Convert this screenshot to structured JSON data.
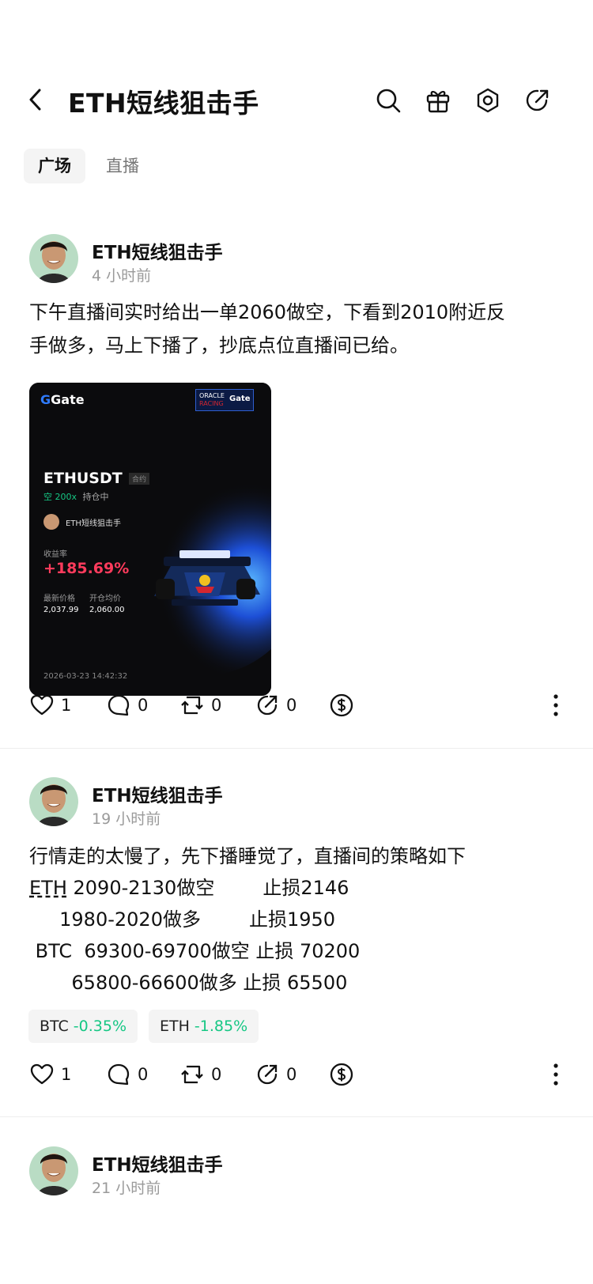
{
  "header": {
    "title": "ETH短线狙击手",
    "icons": [
      "back-icon",
      "search-icon",
      "gift-icon",
      "settings-icon",
      "share-icon"
    ]
  },
  "tabs": [
    {
      "label": "广场",
      "active": true
    },
    {
      "label": "直播",
      "active": false
    }
  ],
  "posts": [
    {
      "author": "ETH短线狙击手",
      "time": "4 小时前",
      "text": [
        "下午直播间实时给出一单2060做空，下看到2010附近反",
        "手做多，马上下播了，抄底点位直播间已给。"
      ],
      "card": {
        "brand": "Gate",
        "badge_line1": "ORACLE",
        "badge_line2": "RACING",
        "badge_brand": "Gate",
        "pair": "ETHUSDT",
        "pair_tag": "合约",
        "direction": "空 200x",
        "status": "持仓中",
        "user": "ETH短线狙击手",
        "roi_label": "收益率",
        "roi": "+185.69%",
        "latest_label": "最新价格",
        "latest": "2,037.99",
        "entry_label": "开仓均价",
        "entry": "2,060.00",
        "timestamp": "2026-03-23 14:42:32"
      },
      "likes": "1",
      "comments": "0",
      "reposts": "0",
      "shares": "0"
    },
    {
      "author": "ETH短线狙击手",
      "time": "19 小时前",
      "text_first": "行情走的太慢了，先下播睡觉了，直播间的策略如下",
      "text_eth_tag": "ETH",
      "text_lines": [
        " 2090-2130做空        止损2146",
        "     1980-2020做多        止损1950",
        " BTC  69300-69700做空 止损 70200",
        "       65800-66600做多 止损 65500"
      ],
      "chips": [
        {
          "symbol": "BTC",
          "change": "-0.35%"
        },
        {
          "symbol": "ETH",
          "change": "-1.85%"
        }
      ],
      "likes": "1",
      "comments": "0",
      "reposts": "0",
      "shares": "0"
    },
    {
      "author": "ETH短线狙击手",
      "time": "21 小时前"
    }
  ],
  "colors": {
    "positive": "#16c784",
    "roi": "#ff3b5c",
    "text": "#111111",
    "muted": "#9a9a9a"
  }
}
